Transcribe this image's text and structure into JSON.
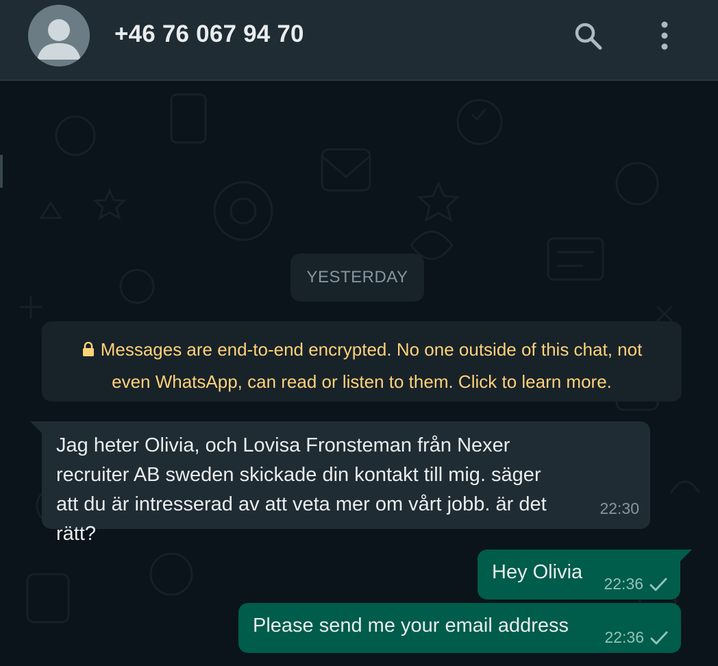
{
  "header": {
    "contact_name": "+46 76 067 94 70",
    "icons": [
      "avatar-icon",
      "search-icon",
      "menu-dots-icon"
    ]
  },
  "chat": {
    "date_divider": "YESTERDAY",
    "encryption_notice": "Messages are end-to-end encrypted. No one outside of this chat, not even WhatsApp, can read or listen to them. Click to learn more.",
    "messages": [
      {
        "direction": "incoming",
        "text": "Jag heter Olivia, och Lovisa Fronsteman från Nexer recruiter AB sweden skickade din kontakt till mig. säger att du är intresserad av att veta mer om vårt jobb. är det rätt?",
        "time": "22:30"
      },
      {
        "direction": "outgoing",
        "text": "Hey Olivia",
        "time": "22:36",
        "status": "sent-check-icon"
      },
      {
        "direction": "outgoing",
        "text": "Please send me your email address",
        "time": "22:36",
        "status": "sent-check-icon"
      }
    ]
  },
  "colors": {
    "header_bg": "#202c33",
    "chat_bg": "#0b141a",
    "incoming_bubble": "#202c33",
    "outgoing_bubble": "#005c4b",
    "notice_text": "#ffd279",
    "meta_text": "#8696a0"
  }
}
